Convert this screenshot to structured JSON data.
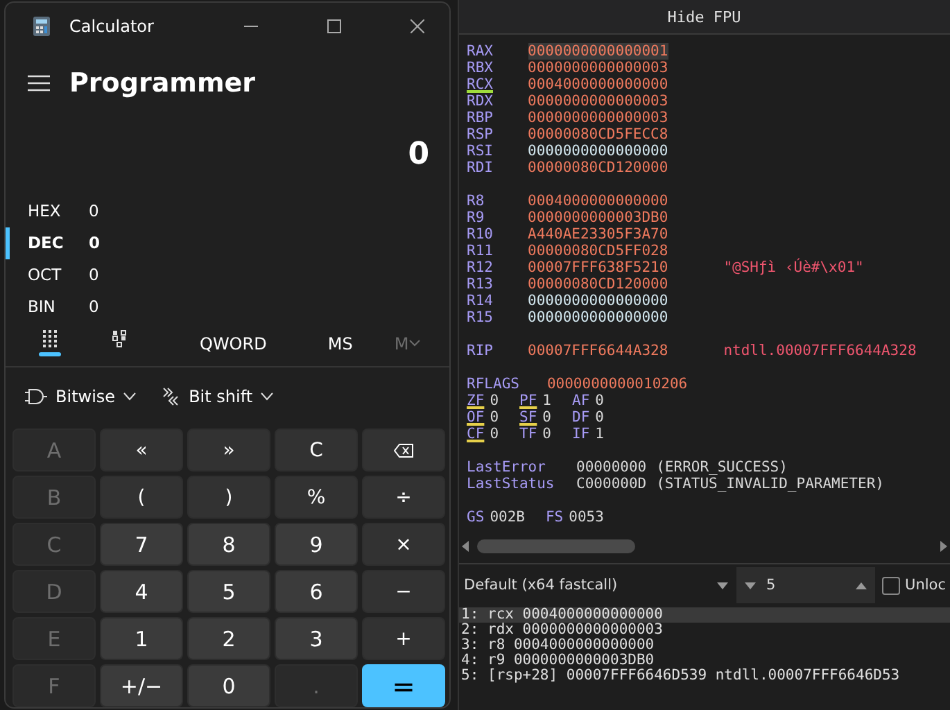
{
  "calculator": {
    "title": "Calculator",
    "mode": "Programmer",
    "display": "0",
    "radixes": [
      {
        "name": "HEX",
        "value": "0",
        "selected": false
      },
      {
        "name": "DEC",
        "value": "0",
        "selected": true
      },
      {
        "name": "OCT",
        "value": "0",
        "selected": false
      },
      {
        "name": "BIN",
        "value": "0",
        "selected": false
      }
    ],
    "view_tabs": [
      {
        "kind": "keypad",
        "selected": true
      },
      {
        "kind": "bits",
        "selected": false
      }
    ],
    "word_size": "QWORD",
    "memory_buttons": [
      {
        "label": "MS",
        "kind": "plain",
        "disabled": false
      },
      {
        "label": "M",
        "kind": "dropdown",
        "disabled": true
      }
    ],
    "dropdowns": [
      {
        "kind": "bitwise",
        "label": "Bitwise"
      },
      {
        "kind": "bitshift",
        "label": "Bit shift"
      }
    ],
    "keys": [
      [
        {
          "label": "A",
          "kind": "hex",
          "disabled": true
        },
        {
          "label": "«",
          "kind": "op",
          "disabled": false
        },
        {
          "label": "»",
          "kind": "op",
          "disabled": false
        },
        {
          "label": "C",
          "kind": "op",
          "disabled": false
        },
        {
          "kind": "backspace",
          "disabled": false
        }
      ],
      [
        {
          "label": "B",
          "kind": "hex",
          "disabled": true
        },
        {
          "label": "(",
          "kind": "op",
          "disabled": false
        },
        {
          "label": ")",
          "kind": "op",
          "disabled": false
        },
        {
          "label": "%",
          "kind": "op",
          "disabled": false
        },
        {
          "label": "÷",
          "kind": "op",
          "disabled": false
        }
      ],
      [
        {
          "label": "C",
          "kind": "hex",
          "disabled": true
        },
        {
          "label": "7",
          "kind": "digit",
          "disabled": false
        },
        {
          "label": "8",
          "kind": "digit",
          "disabled": false
        },
        {
          "label": "9",
          "kind": "digit",
          "disabled": false
        },
        {
          "label": "×",
          "kind": "op",
          "disabled": false
        }
      ],
      [
        {
          "label": "D",
          "kind": "hex",
          "disabled": true
        },
        {
          "label": "4",
          "kind": "digit",
          "disabled": false
        },
        {
          "label": "5",
          "kind": "digit",
          "disabled": false
        },
        {
          "label": "6",
          "kind": "digit",
          "disabled": false
        },
        {
          "label": "−",
          "kind": "op",
          "disabled": false
        }
      ],
      [
        {
          "label": "E",
          "kind": "hex",
          "disabled": true
        },
        {
          "label": "1",
          "kind": "digit",
          "disabled": false
        },
        {
          "label": "2",
          "kind": "digit",
          "disabled": false
        },
        {
          "label": "3",
          "kind": "digit",
          "disabled": false
        },
        {
          "label": "+",
          "kind": "op",
          "disabled": false
        }
      ],
      [
        {
          "label": "F",
          "kind": "hex",
          "disabled": true
        },
        {
          "label": "+/−",
          "kind": "digit",
          "disabled": false
        },
        {
          "label": "0",
          "kind": "digit",
          "disabled": false
        },
        {
          "label": ".",
          "kind": "digit",
          "disabled": true
        },
        {
          "label": "=",
          "kind": "accent",
          "disabled": false
        }
      ]
    ]
  },
  "debugger": {
    "fpu_toggle": "Hide FPU",
    "register_groups": [
      [
        {
          "name": "RAX",
          "value": "0000000000000001",
          "changed": true,
          "selected": true,
          "underlined": false
        },
        {
          "name": "RBX",
          "value": "0000000000000003",
          "changed": true,
          "selected": false,
          "underlined": false
        },
        {
          "name": "RCX",
          "value": "0004000000000000",
          "changed": true,
          "selected": false,
          "underlined": true
        },
        {
          "name": "RDX",
          "value": "0000000000000003",
          "changed": true,
          "selected": false,
          "underlined": false
        },
        {
          "name": "RBP",
          "value": "0000000000000003",
          "changed": true,
          "selected": false,
          "underlined": false
        },
        {
          "name": "RSP",
          "value": "00000080CD5FECC8",
          "changed": true,
          "selected": false,
          "underlined": false
        },
        {
          "name": "RSI",
          "value": "0000000000000000",
          "changed": false,
          "selected": false,
          "underlined": false
        },
        {
          "name": "RDI",
          "value": "00000080CD120000",
          "changed": true,
          "selected": false,
          "underlined": false
        }
      ],
      [
        {
          "name": "R8",
          "value": "0004000000000000",
          "changed": true,
          "selected": false,
          "underlined": false
        },
        {
          "name": "R9",
          "value": "0000000000003DB0",
          "changed": true,
          "selected": false,
          "underlined": false
        },
        {
          "name": "R10",
          "value": "A440AE23305F3A70",
          "changed": true,
          "selected": false,
          "underlined": false
        },
        {
          "name": "R11",
          "value": "00000080CD5FF028",
          "changed": true,
          "selected": false,
          "underlined": false
        },
        {
          "name": "R12",
          "value": "00007FFF638F5210",
          "changed": true,
          "selected": false,
          "underlined": false,
          "comment": "\"@SHƒì ‹Úè#\\x01\""
        },
        {
          "name": "R13",
          "value": "00000080CD120000",
          "changed": true,
          "selected": false,
          "underlined": false
        },
        {
          "name": "R14",
          "value": "0000000000000000",
          "changed": false,
          "selected": false,
          "underlined": false
        },
        {
          "name": "R15",
          "value": "0000000000000000",
          "changed": false,
          "selected": false,
          "underlined": false
        }
      ],
      [
        {
          "name": "RIP",
          "value": "00007FFF6644A328",
          "changed": true,
          "selected": false,
          "underlined": false,
          "comment": "ntdll.00007FFF6644A328"
        }
      ]
    ],
    "rflags": {
      "name": "RFLAGS",
      "value": "0000000000010206"
    },
    "flag_rows": [
      [
        {
          "name": "ZF",
          "value": "0",
          "underlined": true
        },
        {
          "name": "PF",
          "value": "1",
          "underlined": true
        },
        {
          "name": "AF",
          "value": "0",
          "underlined": false
        }
      ],
      [
        {
          "name": "OF",
          "value": "0",
          "underlined": true
        },
        {
          "name": "SF",
          "value": "0",
          "underlined": true
        },
        {
          "name": "DF",
          "value": "0",
          "underlined": false
        }
      ],
      [
        {
          "name": "CF",
          "value": "0",
          "underlined": true
        },
        {
          "name": "TF",
          "value": "0",
          "underlined": false
        },
        {
          "name": "IF",
          "value": "1",
          "underlined": false
        }
      ]
    ],
    "error_lines": [
      {
        "name": "LastError",
        "value": "00000000",
        "description": "(ERROR_SUCCESS)"
      },
      {
        "name": "LastStatus",
        "value": "C000000D",
        "description": "(STATUS_INVALID_PARAMETER)"
      }
    ],
    "segments": [
      {
        "name": "GS",
        "value": "002B"
      },
      {
        "name": "FS",
        "value": "0053"
      }
    ],
    "calling_convention": "Default (x64 fastcall)",
    "arg_count": "5",
    "unlock": {
      "label": "Unloc",
      "checked": false
    },
    "arguments": [
      {
        "text": "1: rcx 0004000000000000",
        "selected": true
      },
      {
        "text": "2: rdx 0000000000000003",
        "selected": false
      },
      {
        "text": "3: r8 0004000000000000",
        "selected": false
      },
      {
        "text": "4: r9 0000000000003DB0",
        "selected": false
      },
      {
        "text": "5: [rsp+28] 00007FFF6646D539 ntdll.00007FFF6646D53",
        "selected": false
      }
    ]
  }
}
